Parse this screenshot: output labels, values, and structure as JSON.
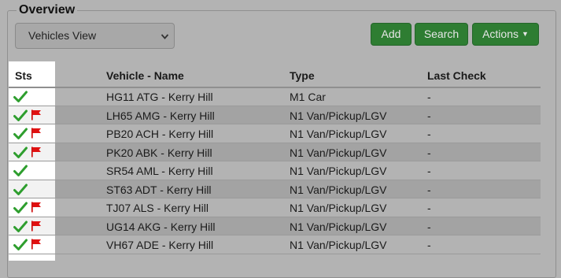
{
  "panel": {
    "title": "Overview"
  },
  "toolbar": {
    "view_select": "Vehicles View",
    "add_label": "Add",
    "search_label": "Search",
    "actions_label": "Actions"
  },
  "table": {
    "columns": [
      "Sts",
      "Vehicle - Name",
      "Type",
      "Last Check"
    ],
    "rows": [
      {
        "vehicle": "HG11 ATG - Kerry Hill",
        "type": "M1 Car",
        "last_check": "-",
        "flag": false
      },
      {
        "vehicle": "LH65 AMG - Kerry Hill",
        "type": "N1 Van/Pickup/LGV",
        "last_check": "-",
        "flag": true
      },
      {
        "vehicle": "PB20 ACH - Kerry Hill",
        "type": "N1 Van/Pickup/LGV",
        "last_check": "-",
        "flag": true
      },
      {
        "vehicle": "PK20 ABK - Kerry Hill",
        "type": "N1 Van/Pickup/LGV",
        "last_check": "-",
        "flag": true
      },
      {
        "vehicle": "SR54 AML - Kerry Hill",
        "type": "N1 Van/Pickup/LGV",
        "last_check": "-",
        "flag": false
      },
      {
        "vehicle": "ST63 ADT - Kerry Hill",
        "type": "N1 Van/Pickup/LGV",
        "last_check": "-",
        "flag": false
      },
      {
        "vehicle": "TJ07 ALS - Kerry Hill",
        "type": "N1 Van/Pickup/LGV",
        "last_check": "-",
        "flag": true
      },
      {
        "vehicle": "UG14 AKG - Kerry Hill",
        "type": "N1 Van/Pickup/LGV",
        "last_check": "-",
        "flag": true
      },
      {
        "vehicle": "VH67 ADE - Kerry Hill",
        "type": "N1 Van/Pickup/LGV",
        "last_check": "-",
        "flag": true
      }
    ]
  },
  "icons": {
    "status": "check-icon",
    "flag": "red-flag-icon"
  },
  "colors": {
    "button": "#2e7d32",
    "check": "#2e9e2e",
    "flag": "#e01010"
  }
}
